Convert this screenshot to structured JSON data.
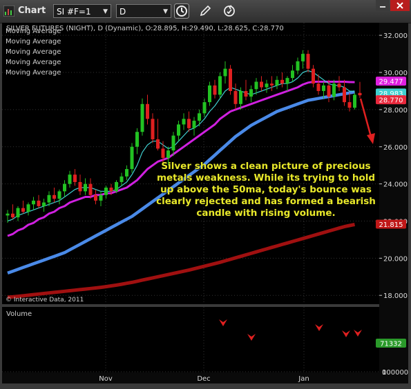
{
  "window": {
    "title": "Chart",
    "symbol": "SI #F=1",
    "period": "D"
  },
  "chart": {
    "header": "SILVER FUTURES (NIGHT), D (Dynamic), O:28.895, H:29.490, L:28.625, C:28.770",
    "legend": [
      "Moving Average",
      "Moving Average",
      "Moving Average",
      "Moving Average",
      "Moving Average"
    ],
    "copyright": "© Interactive Data, 2011",
    "volume_label": "Volume",
    "annotation": "Silver shows a clean picture of precious metals weakness. While its trying to hold up above the 50ma, today's bounce was clearly rejected and has formed a bearish candle with rising volume.",
    "price_ticks": [
      "32.000",
      "30.000",
      "28.000",
      "26.000",
      "24.000",
      "22.000",
      "20.000",
      "18.000"
    ],
    "price_tick_values": [
      32,
      30,
      28,
      26,
      24,
      22,
      20,
      18
    ],
    "volume_ticks": [
      "100000",
      "0"
    ],
    "x_labels": [
      "Nov",
      "Dec",
      "Jan"
    ],
    "badges": [
      {
        "label": "29.477",
        "value": 29.477,
        "color": "#e020e0"
      },
      {
        "label": "28.983",
        "value": 28.983,
        "color": "#40d0d0"
      },
      {
        "label": "28.770",
        "value": 28.77,
        "color": "#e8283c"
      },
      {
        "label": "21.815",
        "value": 21.815,
        "color": "#c01818"
      }
    ],
    "volume_badge": {
      "label": "71332",
      "color": "#2a9a2a"
    }
  },
  "colors": {
    "up": "#22c222",
    "down": "#e02020",
    "ma_fast": "#40d0d0",
    "ma_mid": "#d020e0",
    "ma_50": "#4a8ae8",
    "ma_200": "#a01010",
    "annotation": "#e8e82a",
    "arrow": "#e02020"
  },
  "chart_data": {
    "type": "candlestick",
    "ylim": [
      17.6,
      32.6
    ],
    "y_grid": [
      32,
      30,
      28,
      26,
      24,
      22,
      20,
      18
    ],
    "candles": [
      {
        "o": 22.3,
        "h": 22.6,
        "l": 21.9,
        "c": 22.4
      },
      {
        "o": 22.4,
        "h": 22.9,
        "l": 22.1,
        "c": 22.2
      },
      {
        "o": 22.2,
        "h": 22.8,
        "l": 22.0,
        "c": 22.7
      },
      {
        "o": 22.7,
        "h": 23.1,
        "l": 22.4,
        "c": 22.5
      },
      {
        "o": 22.5,
        "h": 23.0,
        "l": 22.3,
        "c": 22.9
      },
      {
        "o": 22.9,
        "h": 23.3,
        "l": 22.6,
        "c": 23.1
      },
      {
        "o": 23.1,
        "h": 23.4,
        "l": 22.7,
        "c": 22.8
      },
      {
        "o": 22.8,
        "h": 23.2,
        "l": 22.5,
        "c": 23.0
      },
      {
        "o": 23.0,
        "h": 23.6,
        "l": 22.8,
        "c": 23.4
      },
      {
        "o": 23.4,
        "h": 23.8,
        "l": 23.0,
        "c": 23.2
      },
      {
        "o": 23.2,
        "h": 23.7,
        "l": 22.9,
        "c": 23.6
      },
      {
        "o": 23.6,
        "h": 24.2,
        "l": 23.3,
        "c": 24.0
      },
      {
        "o": 24.0,
        "h": 24.7,
        "l": 23.8,
        "c": 24.5
      },
      {
        "o": 24.5,
        "h": 24.8,
        "l": 23.9,
        "c": 24.1
      },
      {
        "o": 24.1,
        "h": 24.5,
        "l": 23.4,
        "c": 23.6
      },
      {
        "o": 23.6,
        "h": 24.3,
        "l": 23.4,
        "c": 24.0
      },
      {
        "o": 24.0,
        "h": 24.3,
        "l": 23.2,
        "c": 23.4
      },
      {
        "o": 23.4,
        "h": 23.7,
        "l": 22.9,
        "c": 23.1
      },
      {
        "o": 23.1,
        "h": 23.6,
        "l": 22.8,
        "c": 23.4
      },
      {
        "o": 23.4,
        "h": 23.9,
        "l": 23.2,
        "c": 23.8
      },
      {
        "o": 23.8,
        "h": 24.0,
        "l": 23.4,
        "c": 23.6
      },
      {
        "o": 23.6,
        "h": 24.2,
        "l": 23.5,
        "c": 24.1
      },
      {
        "o": 24.1,
        "h": 24.6,
        "l": 23.9,
        "c": 24.4
      },
      {
        "o": 24.4,
        "h": 25.0,
        "l": 24.2,
        "c": 24.8
      },
      {
        "o": 24.8,
        "h": 26.2,
        "l": 24.6,
        "c": 26.0
      },
      {
        "o": 26.0,
        "h": 27.0,
        "l": 25.6,
        "c": 26.8
      },
      {
        "o": 26.8,
        "h": 28.6,
        "l": 26.6,
        "c": 28.3
      },
      {
        "o": 28.3,
        "h": 28.8,
        "l": 27.2,
        "c": 27.5
      },
      {
        "o": 27.5,
        "h": 27.8,
        "l": 26.2,
        "c": 26.4
      },
      {
        "o": 26.4,
        "h": 27.5,
        "l": 25.8,
        "c": 25.9
      },
      {
        "o": 25.9,
        "h": 26.3,
        "l": 25.0,
        "c": 25.4
      },
      {
        "o": 25.4,
        "h": 26.0,
        "l": 25.0,
        "c": 25.8
      },
      {
        "o": 25.8,
        "h": 26.8,
        "l": 25.5,
        "c": 26.6
      },
      {
        "o": 26.6,
        "h": 27.4,
        "l": 26.3,
        "c": 27.2
      },
      {
        "o": 27.2,
        "h": 27.8,
        "l": 26.9,
        "c": 27.5
      },
      {
        "o": 27.5,
        "h": 27.9,
        "l": 26.8,
        "c": 27.0
      },
      {
        "o": 27.0,
        "h": 27.6,
        "l": 26.6,
        "c": 27.4
      },
      {
        "o": 27.4,
        "h": 28.0,
        "l": 27.1,
        "c": 27.8
      },
      {
        "o": 27.8,
        "h": 28.6,
        "l": 27.6,
        "c": 28.4
      },
      {
        "o": 28.4,
        "h": 29.5,
        "l": 28.2,
        "c": 29.3
      },
      {
        "o": 29.3,
        "h": 29.6,
        "l": 28.6,
        "c": 28.8
      },
      {
        "o": 28.8,
        "h": 30.0,
        "l": 28.6,
        "c": 29.8
      },
      {
        "o": 29.8,
        "h": 30.6,
        "l": 29.4,
        "c": 30.2
      },
      {
        "o": 30.2,
        "h": 30.4,
        "l": 28.8,
        "c": 29.0
      },
      {
        "o": 29.0,
        "h": 29.4,
        "l": 28.0,
        "c": 28.3
      },
      {
        "o": 28.3,
        "h": 29.2,
        "l": 28.0,
        "c": 29.0
      },
      {
        "o": 29.0,
        "h": 29.6,
        "l": 28.5,
        "c": 28.7
      },
      {
        "o": 28.7,
        "h": 29.3,
        "l": 28.4,
        "c": 29.1
      },
      {
        "o": 29.1,
        "h": 29.7,
        "l": 28.8,
        "c": 29.5
      },
      {
        "o": 29.5,
        "h": 29.8,
        "l": 29.0,
        "c": 29.2
      },
      {
        "o": 29.2,
        "h": 29.6,
        "l": 28.9,
        "c": 29.4
      },
      {
        "o": 29.4,
        "h": 29.8,
        "l": 29.0,
        "c": 29.3
      },
      {
        "o": 29.3,
        "h": 29.8,
        "l": 29.1,
        "c": 29.6
      },
      {
        "o": 29.6,
        "h": 30.0,
        "l": 29.2,
        "c": 29.4
      },
      {
        "o": 29.4,
        "h": 29.8,
        "l": 29.0,
        "c": 29.7
      },
      {
        "o": 29.7,
        "h": 30.4,
        "l": 29.5,
        "c": 30.1
      },
      {
        "o": 30.1,
        "h": 30.8,
        "l": 29.9,
        "c": 30.6
      },
      {
        "o": 30.6,
        "h": 31.2,
        "l": 30.2,
        "c": 31.0
      },
      {
        "o": 31.0,
        "h": 31.2,
        "l": 30.0,
        "c": 30.2
      },
      {
        "o": 30.2,
        "h": 30.4,
        "l": 29.2,
        "c": 29.4
      },
      {
        "o": 29.4,
        "h": 29.9,
        "l": 28.8,
        "c": 29.0
      },
      {
        "o": 29.0,
        "h": 29.5,
        "l": 28.6,
        "c": 29.3
      },
      {
        "o": 29.3,
        "h": 29.6,
        "l": 28.4,
        "c": 28.7
      },
      {
        "o": 28.7,
        "h": 29.6,
        "l": 28.5,
        "c": 29.4
      },
      {
        "o": 29.4,
        "h": 29.8,
        "l": 29.0,
        "c": 29.2
      },
      {
        "o": 29.2,
        "h": 29.6,
        "l": 28.2,
        "c": 28.4
      },
      {
        "o": 28.4,
        "h": 28.9,
        "l": 27.9,
        "c": 28.1
      },
      {
        "o": 28.1,
        "h": 28.9,
        "l": 28.0,
        "c": 28.8
      },
      {
        "o": 28.895,
        "h": 29.49,
        "l": 28.625,
        "c": 28.77
      }
    ],
    "volume": [
      22,
      30,
      38,
      26,
      34,
      28,
      30,
      44,
      36,
      30,
      42,
      38,
      48,
      40,
      30,
      36,
      46,
      52,
      60,
      44,
      38,
      34,
      40,
      50,
      54,
      62,
      100,
      74,
      70,
      48,
      44,
      56,
      52,
      58,
      44,
      50,
      48,
      52,
      60,
      72,
      58,
      80,
      98,
      92,
      76,
      48,
      52,
      44,
      62,
      48,
      54,
      58,
      42,
      50,
      46,
      54,
      70,
      62,
      52,
      96,
      84,
      64,
      58,
      60,
      74,
      80,
      86,
      72
    ],
    "volume_ylim": [
      0,
      140000
    ],
    "ma_fast": [
      22.0,
      22.1,
      22.3,
      22.4,
      22.5,
      22.6,
      22.7,
      22.8,
      22.9,
      23.0,
      23.1,
      23.3,
      23.5,
      23.7,
      23.8,
      23.8,
      23.8,
      23.7,
      23.6,
      23.6,
      23.6,
      23.7,
      23.9,
      24.1,
      24.5,
      25.0,
      25.7,
      26.1,
      26.3,
      26.3,
      26.1,
      25.9,
      26.0,
      26.3,
      26.6,
      26.9,
      27.0,
      27.2,
      27.5,
      27.9,
      28.2,
      28.6,
      29.0,
      29.2,
      29.1,
      29.0,
      28.9,
      28.8,
      28.9,
      29.0,
      29.1,
      29.2,
      29.3,
      29.4,
      29.4,
      29.5,
      29.7,
      30.0,
      30.1,
      30.0,
      29.8,
      29.6,
      29.4,
      29.3,
      29.3,
      29.2,
      29.0,
      28.98
    ],
    "ma_mid": [
      21.2,
      21.3,
      21.5,
      21.6,
      21.8,
      21.9,
      22.1,
      22.2,
      22.4,
      22.5,
      22.7,
      22.8,
      23.0,
      23.1,
      23.2,
      23.3,
      23.3,
      23.4,
      23.4,
      23.5,
      23.5,
      23.6,
      23.7,
      23.8,
      24.0,
      24.2,
      24.5,
      24.8,
      25.0,
      25.2,
      25.3,
      25.4,
      25.6,
      25.8,
      26.0,
      26.2,
      26.4,
      26.6,
      26.8,
      27.0,
      27.2,
      27.5,
      27.7,
      27.9,
      28.0,
      28.1,
      28.2,
      28.3,
      28.4,
      28.5,
      28.6,
      28.7,
      28.8,
      28.9,
      29.0,
      29.1,
      29.2,
      29.35,
      29.45,
      29.5,
      29.5,
      29.5,
      29.5,
      29.5,
      29.5,
      29.5,
      29.48,
      29.477
    ],
    "ma_50": [
      19.2,
      19.3,
      19.4,
      19.5,
      19.6,
      19.7,
      19.8,
      19.9,
      20.0,
      20.1,
      20.2,
      20.3,
      20.45,
      20.6,
      20.75,
      20.9,
      21.05,
      21.2,
      21.35,
      21.5,
      21.65,
      21.8,
      21.95,
      22.1,
      22.25,
      22.45,
      22.65,
      22.85,
      23.05,
      23.25,
      23.45,
      23.65,
      23.85,
      24.05,
      24.25,
      24.45,
      24.65,
      24.85,
      25.05,
      25.3,
      25.55,
      25.8,
      26.05,
      26.3,
      26.55,
      26.75,
      26.95,
      27.15,
      27.3,
      27.45,
      27.6,
      27.75,
      27.9,
      28.0,
      28.1,
      28.2,
      28.3,
      28.4,
      28.5,
      28.55,
      28.6,
      28.65,
      28.7,
      28.75,
      28.8,
      28.85,
      28.9,
      28.95
    ],
    "ma_200": [
      17.9,
      17.92,
      17.95,
      17.98,
      18.01,
      18.04,
      18.07,
      18.1,
      18.13,
      18.16,
      18.19,
      18.22,
      18.25,
      18.28,
      18.31,
      18.34,
      18.37,
      18.4,
      18.43,
      18.47,
      18.51,
      18.55,
      18.6,
      18.65,
      18.7,
      18.76,
      18.82,
      18.88,
      18.94,
      19.0,
      19.06,
      19.12,
      19.18,
      19.24,
      19.3,
      19.36,
      19.43,
      19.5,
      19.57,
      19.64,
      19.71,
      19.78,
      19.86,
      19.94,
      20.02,
      20.1,
      20.18,
      20.26,
      20.34,
      20.42,
      20.5,
      20.58,
      20.66,
      20.74,
      20.82,
      20.9,
      20.98,
      21.06,
      21.14,
      21.22,
      21.3,
      21.38,
      21.46,
      21.54,
      21.62,
      21.7,
      21.76,
      21.815
    ]
  }
}
